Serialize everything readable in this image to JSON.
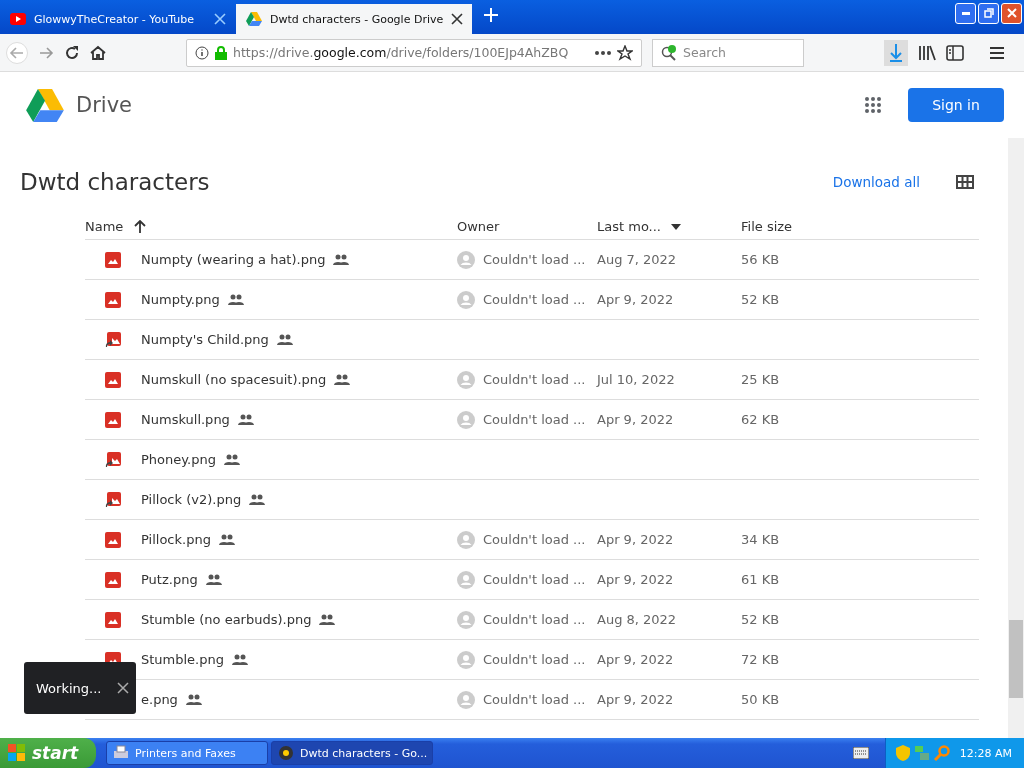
{
  "browser": {
    "tabs": [
      {
        "title": "GlowwyTheCreator - YouTube",
        "kind": "youtube",
        "selected": false
      },
      {
        "title": "Dwtd characters - Google Drive",
        "kind": "drive",
        "selected": true
      }
    ],
    "url": {
      "prefix": "https://drive.",
      "domain": "google.com",
      "path": "/drive/folders/100EJp4AhZBQ"
    },
    "search": {
      "placeholder": "Search"
    }
  },
  "drive": {
    "app_name": "Drive",
    "sign_in": "Sign in",
    "folder_title": "Dwtd characters",
    "download_all": "Download all",
    "columns": [
      {
        "label": "Name",
        "sorted": true,
        "descending": false
      },
      {
        "label": "Owner",
        "sorted": false
      },
      {
        "label": "Last mo...",
        "sorted": true,
        "descending": true
      },
      {
        "label": "File size",
        "sorted": false
      }
    ],
    "rows": [
      {
        "name": "Numpty (wearing a hat).png",
        "kind": "image",
        "owner": "Couldn't load ...",
        "modified": "Aug 7, 2022",
        "size": "56 KB"
      },
      {
        "name": "Numpty.png",
        "kind": "image",
        "owner": "Couldn't load ...",
        "modified": "Apr 9, 2022",
        "size": "52 KB"
      },
      {
        "name": "Numpty's Child.png",
        "kind": "shortcut"
      },
      {
        "name": "Numskull (no spacesuit).png",
        "kind": "image",
        "owner": "Couldn't load ...",
        "modified": "Jul 10, 2022",
        "size": "25 KB"
      },
      {
        "name": "Numskull.png",
        "kind": "image",
        "owner": "Couldn't load ...",
        "modified": "Apr 9, 2022",
        "size": "62 KB"
      },
      {
        "name": "Phoney.png",
        "kind": "shortcut"
      },
      {
        "name": "Pillock (v2).png",
        "kind": "shortcut"
      },
      {
        "name": "Pillock.png",
        "kind": "image",
        "owner": "Couldn't load ...",
        "modified": "Apr 9, 2022",
        "size": "34 KB"
      },
      {
        "name": "Putz.png",
        "kind": "image",
        "owner": "Couldn't load ...",
        "modified": "Apr 9, 2022",
        "size": "61 KB"
      },
      {
        "name": "Stumble (no earbuds).png",
        "kind": "image",
        "owner": "Couldn't load ...",
        "modified": "Aug 8, 2022",
        "size": "52 KB"
      },
      {
        "name": "Stumble.png",
        "kind": "image",
        "owner": "Couldn't load ...",
        "modified": "Apr 9, 2022",
        "size": "72 KB"
      },
      {
        "name": "e.png",
        "owner": "Couldn't load ...",
        "modified": "Apr 9, 2022",
        "size": "50 KB"
      }
    ],
    "toast": {
      "text": "Working..."
    }
  },
  "taskbar": {
    "start": "start",
    "tasks": [
      {
        "label": "Printers and Faxes",
        "selected": false
      },
      {
        "label": "Dwtd characters - Go...",
        "selected": true
      }
    ],
    "clock": "12:28 AM"
  }
}
